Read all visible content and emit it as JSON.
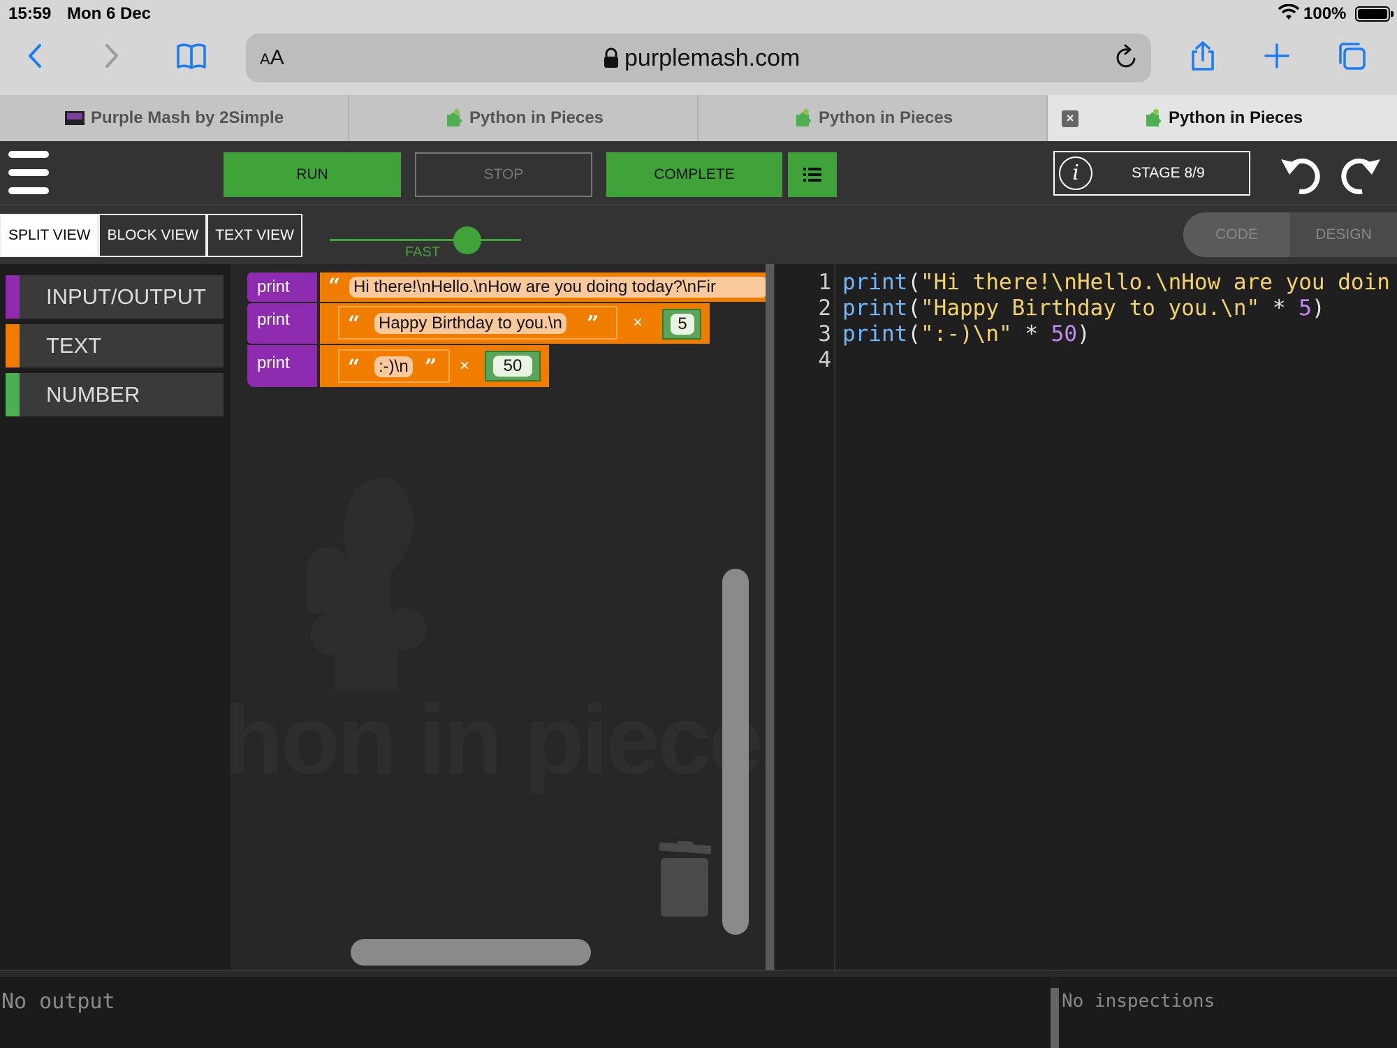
{
  "statusbar": {
    "time": "15:59",
    "date": "Mon 6 Dec",
    "battery": "100%"
  },
  "browser": {
    "aa_small": "A",
    "aa_large": "A",
    "host": "purplemash.com",
    "tabs": [
      {
        "title": "Purple Mash by 2Simple"
      },
      {
        "title": "Python in Pieces"
      },
      {
        "title": "Python in Pieces"
      },
      {
        "title": "Python in Pieces"
      }
    ]
  },
  "appbar": {
    "run": "RUN",
    "stop": "STOP",
    "complete": "COMPLETE",
    "stage": "STAGE 8/9",
    "info_glyph": "i"
  },
  "views": {
    "tabs": [
      "SPLIT VIEW",
      "BLOCK VIEW",
      "TEXT VIEW"
    ],
    "speed_label": "FAST",
    "speed_level": 0.72,
    "mode": [
      "CODE",
      "DESIGN"
    ]
  },
  "categories": [
    {
      "label": "INPUT/OUTPUT",
      "color": "#8e2bb0"
    },
    {
      "label": "TEXT",
      "color": "#f07d00"
    },
    {
      "label": "NUMBER",
      "color": "#4caf50"
    }
  ],
  "blocks": {
    "print_label": "print",
    "times": "×",
    "b1_text": "Hi there!\\nHello.\\nHow are you doing today?\\nFir",
    "b2_text": "Happy Birthday to you.\\n",
    "b2_num": "5",
    "b3_text": ":-)\\n",
    "b3_num": "50",
    "open_quote": "“",
    "close_quote": "”"
  },
  "watermark": "hon in pieces",
  "code": {
    "line_numbers": [
      "1",
      "2",
      "3",
      "4"
    ],
    "l1_fn": "print",
    "l1_open": "(",
    "l1_str": "\"Hi there!\\nHello.\\nHow are you doin",
    "l2_fn": "print",
    "l2_open": "(",
    "l2_str": "\"Happy Birthday to you.\\n\"",
    "l2_op": " * ",
    "l2_num": "5",
    "l2_close": ")",
    "l3_fn": "print",
    "l3_open": "(",
    "l3_str": "\":-)\\n\"",
    "l3_op": " * ",
    "l3_num": "50",
    "l3_close": ")"
  },
  "output": {
    "text": "No output"
  },
  "inspections": {
    "text": "No inspections"
  }
}
